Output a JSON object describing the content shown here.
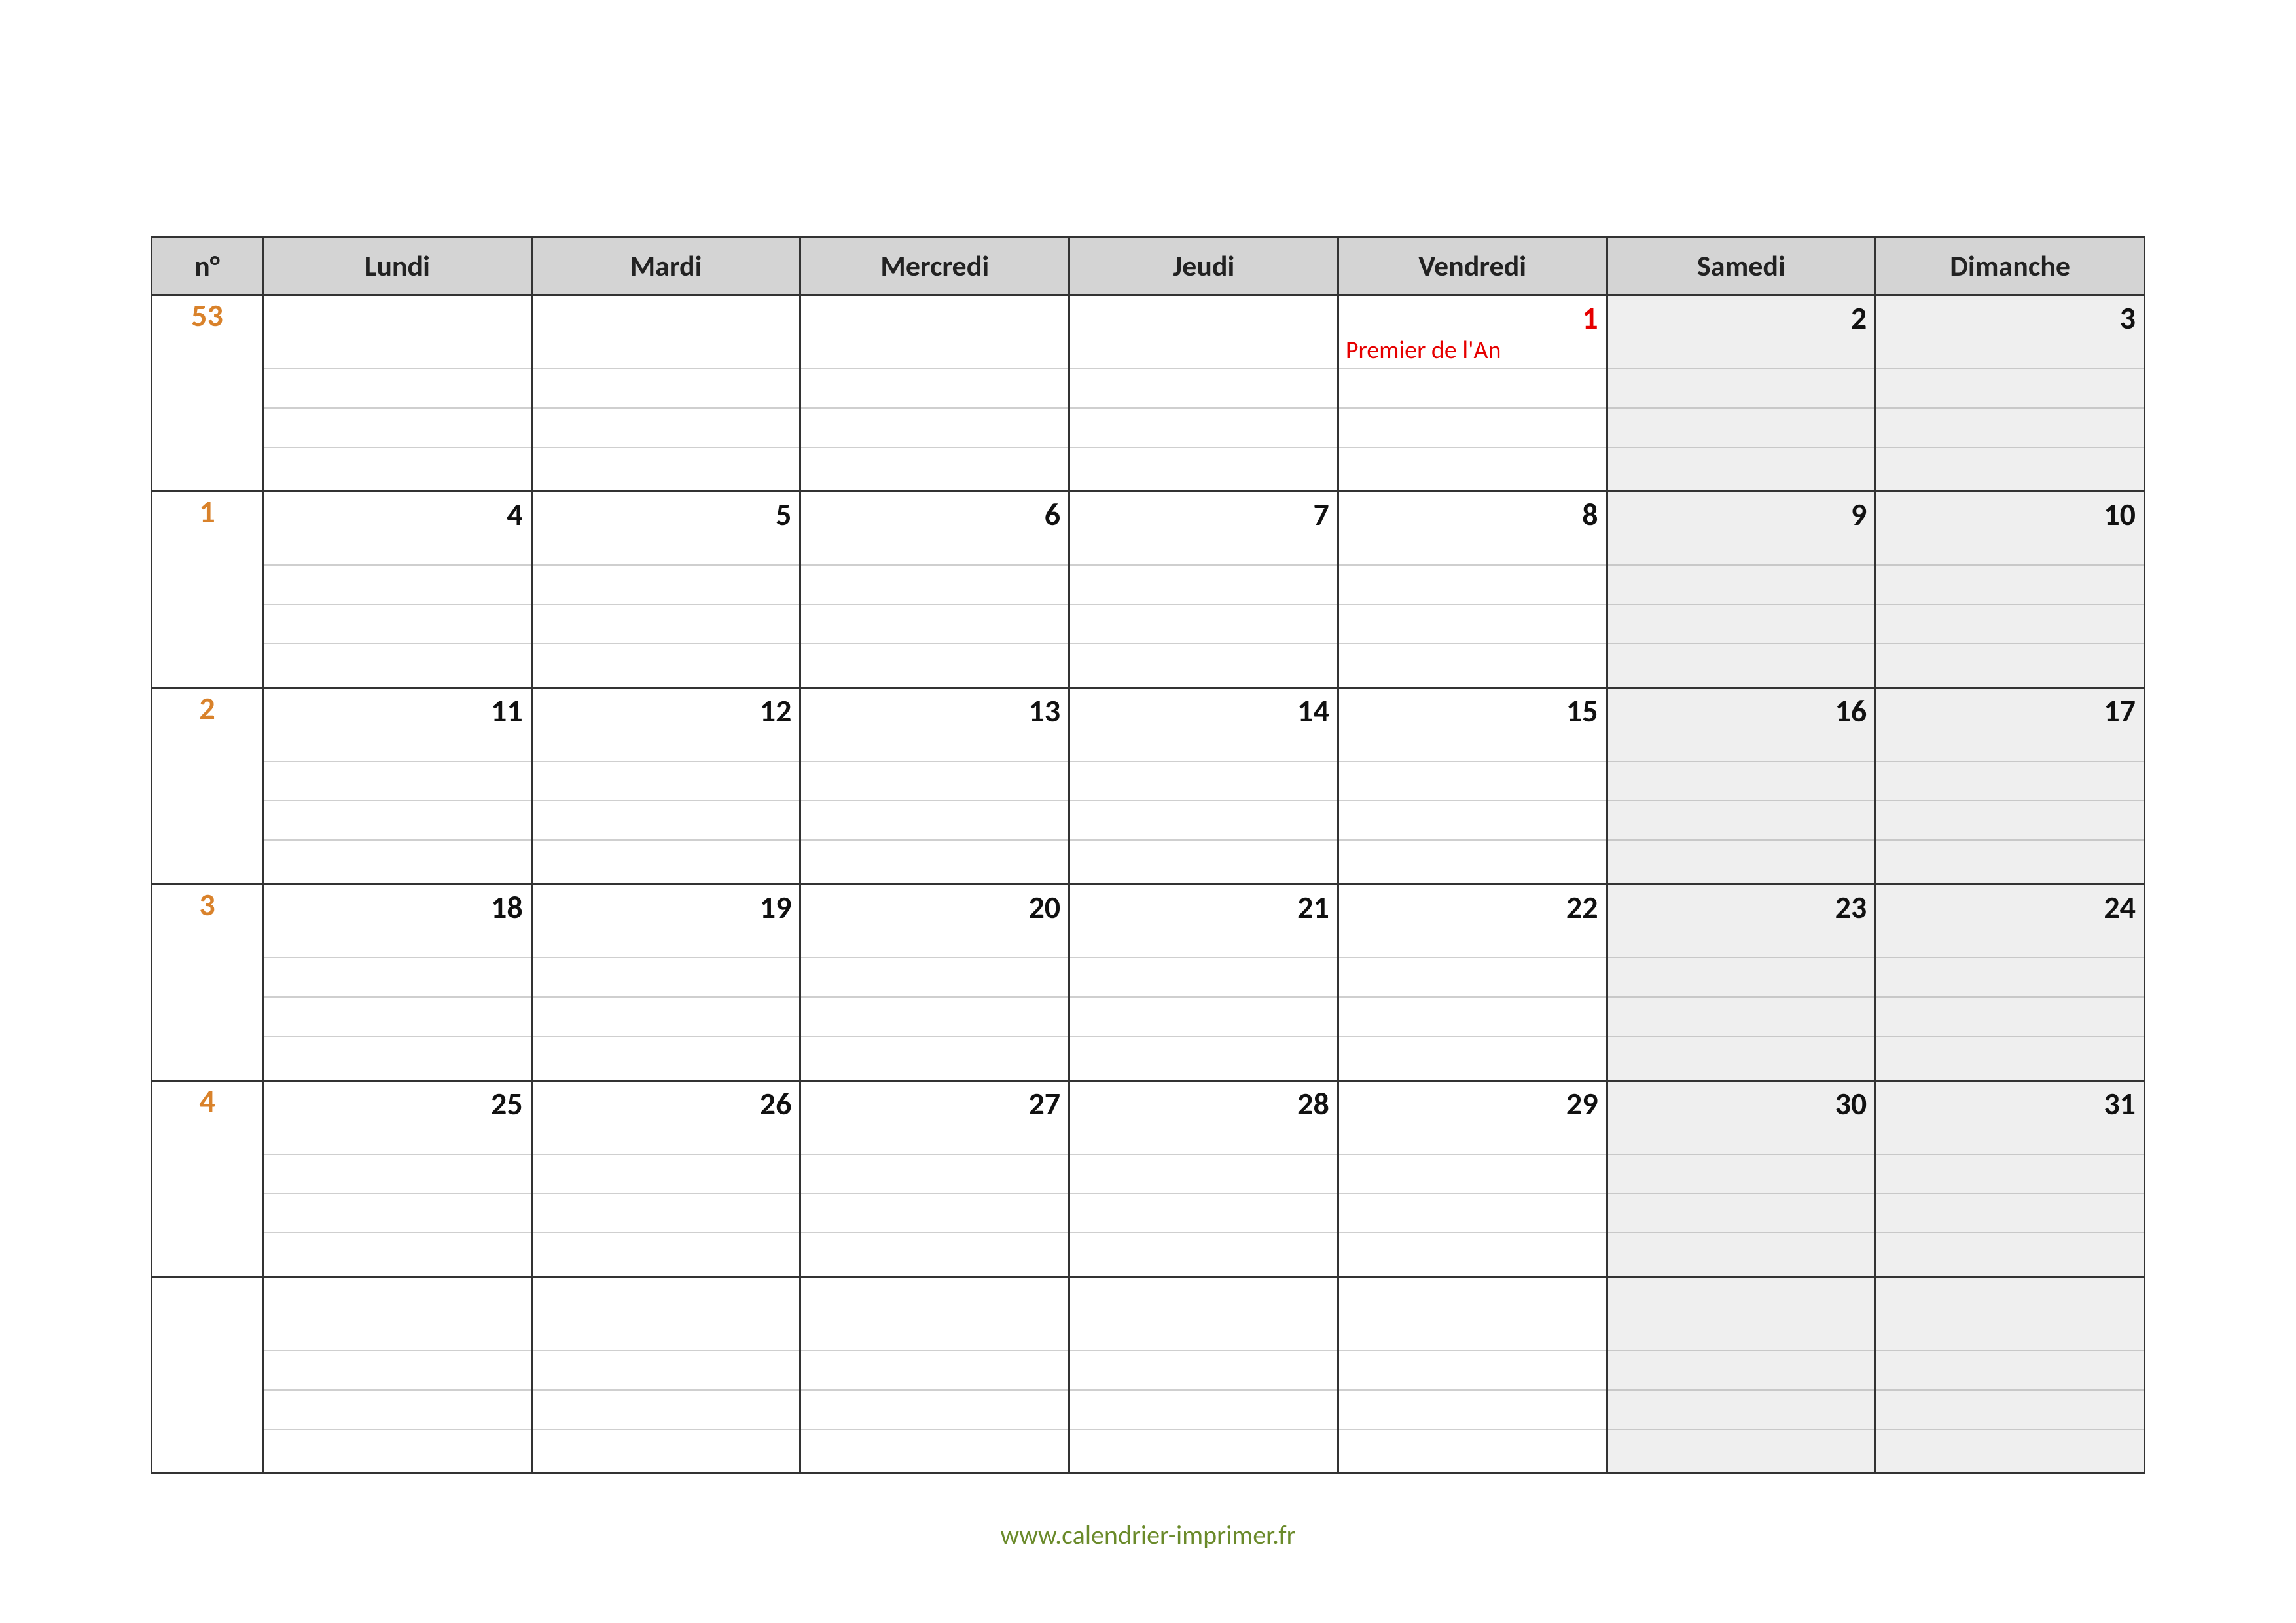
{
  "header": {
    "week_column_label": "n°",
    "days": [
      "Lundi",
      "Mardi",
      "Mercredi",
      "Jeudi",
      "Vendredi",
      "Samedi",
      "Dimanche"
    ]
  },
  "weeks": [
    {
      "num": "53",
      "days": [
        {
          "date": "",
          "event": "",
          "weekend": false,
          "holiday": false
        },
        {
          "date": "",
          "event": "",
          "weekend": false,
          "holiday": false
        },
        {
          "date": "",
          "event": "",
          "weekend": false,
          "holiday": false
        },
        {
          "date": "",
          "event": "",
          "weekend": false,
          "holiday": false
        },
        {
          "date": "1",
          "event": "Premier de l'An",
          "weekend": false,
          "holiday": true
        },
        {
          "date": "2",
          "event": "",
          "weekend": true,
          "holiday": false
        },
        {
          "date": "3",
          "event": "",
          "weekend": true,
          "holiday": false
        }
      ]
    },
    {
      "num": "1",
      "days": [
        {
          "date": "4",
          "event": "",
          "weekend": false,
          "holiday": false
        },
        {
          "date": "5",
          "event": "",
          "weekend": false,
          "holiday": false
        },
        {
          "date": "6",
          "event": "",
          "weekend": false,
          "holiday": false
        },
        {
          "date": "7",
          "event": "",
          "weekend": false,
          "holiday": false
        },
        {
          "date": "8",
          "event": "",
          "weekend": false,
          "holiday": false
        },
        {
          "date": "9",
          "event": "",
          "weekend": true,
          "holiday": false
        },
        {
          "date": "10",
          "event": "",
          "weekend": true,
          "holiday": false
        }
      ]
    },
    {
      "num": "2",
      "days": [
        {
          "date": "11",
          "event": "",
          "weekend": false,
          "holiday": false
        },
        {
          "date": "12",
          "event": "",
          "weekend": false,
          "holiday": false
        },
        {
          "date": "13",
          "event": "",
          "weekend": false,
          "holiday": false
        },
        {
          "date": "14",
          "event": "",
          "weekend": false,
          "holiday": false
        },
        {
          "date": "15",
          "event": "",
          "weekend": false,
          "holiday": false
        },
        {
          "date": "16",
          "event": "",
          "weekend": true,
          "holiday": false
        },
        {
          "date": "17",
          "event": "",
          "weekend": true,
          "holiday": false
        }
      ]
    },
    {
      "num": "3",
      "days": [
        {
          "date": "18",
          "event": "",
          "weekend": false,
          "holiday": false
        },
        {
          "date": "19",
          "event": "",
          "weekend": false,
          "holiday": false
        },
        {
          "date": "20",
          "event": "",
          "weekend": false,
          "holiday": false
        },
        {
          "date": "21",
          "event": "",
          "weekend": false,
          "holiday": false
        },
        {
          "date": "22",
          "event": "",
          "weekend": false,
          "holiday": false
        },
        {
          "date": "23",
          "event": "",
          "weekend": true,
          "holiday": false
        },
        {
          "date": "24",
          "event": "",
          "weekend": true,
          "holiday": false
        }
      ]
    },
    {
      "num": "4",
      "days": [
        {
          "date": "25",
          "event": "",
          "weekend": false,
          "holiday": false
        },
        {
          "date": "26",
          "event": "",
          "weekend": false,
          "holiday": false
        },
        {
          "date": "27",
          "event": "",
          "weekend": false,
          "holiday": false
        },
        {
          "date": "28",
          "event": "",
          "weekend": false,
          "holiday": false
        },
        {
          "date": "29",
          "event": "",
          "weekend": false,
          "holiday": false
        },
        {
          "date": "30",
          "event": "",
          "weekend": true,
          "holiday": false
        },
        {
          "date": "31",
          "event": "",
          "weekend": true,
          "holiday": false
        }
      ]
    },
    {
      "num": "",
      "days": [
        {
          "date": "",
          "event": "",
          "weekend": false,
          "holiday": false
        },
        {
          "date": "",
          "event": "",
          "weekend": false,
          "holiday": false
        },
        {
          "date": "",
          "event": "",
          "weekend": false,
          "holiday": false
        },
        {
          "date": "",
          "event": "",
          "weekend": false,
          "holiday": false
        },
        {
          "date": "",
          "event": "",
          "weekend": false,
          "holiday": false
        },
        {
          "date": "",
          "event": "",
          "weekend": true,
          "holiday": false
        },
        {
          "date": "",
          "event": "",
          "weekend": true,
          "holiday": false
        }
      ]
    }
  ],
  "footer": {
    "url": "www.calendrier-imprimer.fr"
  }
}
